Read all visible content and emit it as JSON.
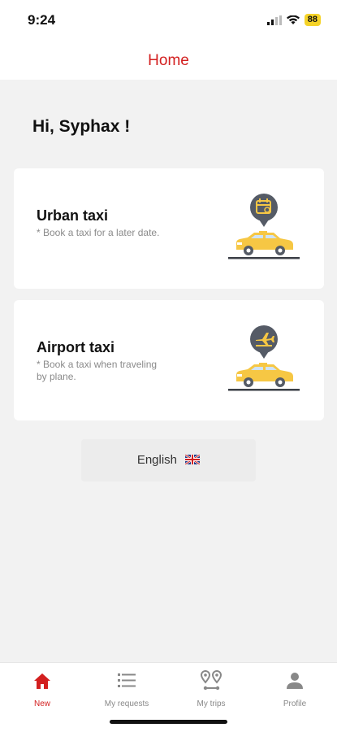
{
  "status_bar": {
    "time": "9:24",
    "battery": "88"
  },
  "header": {
    "title": "Home"
  },
  "greeting": "Hi, Syphax !",
  "cards": [
    {
      "title": "Urban taxi",
      "description": "* Book a taxi for a later date.",
      "icon": "calendar-taxi-icon"
    },
    {
      "title": "Airport taxi",
      "description": "* Book a taxi when traveling by plane.",
      "icon": "airplane-taxi-icon"
    }
  ],
  "language": {
    "label": "English",
    "flag": "uk-flag-icon"
  },
  "nav": {
    "items": [
      {
        "label": "New",
        "icon": "home-icon",
        "active": true
      },
      {
        "label": "My requests",
        "icon": "list-icon",
        "active": false
      },
      {
        "label": "My trips",
        "icon": "route-pins-icon",
        "active": false
      },
      {
        "label": "Profile",
        "icon": "person-icon",
        "active": false
      }
    ]
  },
  "colors": {
    "accent": "#d31f1f",
    "taxi_yellow": "#f6c744",
    "badge_gray": "#555b66",
    "background": "#f2f2f2"
  }
}
